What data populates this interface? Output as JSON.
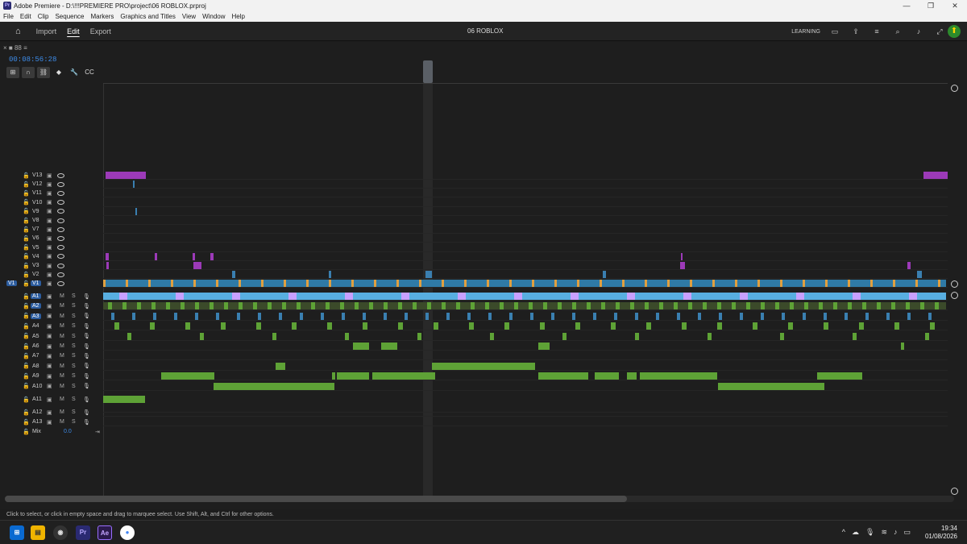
{
  "window": {
    "title": "Adobe Premiere - D:\\!!!PREMIERE PRO\\project\\06 ROBLOX.prproj",
    "controls": [
      "—",
      "❐",
      "✕"
    ]
  },
  "menu": [
    "File",
    "Edit",
    "Clip",
    "Sequence",
    "Markers",
    "Graphics and Titles",
    "View",
    "Window",
    "Help"
  ],
  "header": {
    "tabs": [
      "Import",
      "Edit",
      "Export"
    ],
    "active_tab": "Edit",
    "sequence_name": "06 ROBLOX",
    "learning": "LEARNING"
  },
  "timeline": {
    "panel_label": "× ■ 88 ≡",
    "timecode": "00:08:56:28",
    "video_tracks": [
      "V13",
      "V12",
      "V11",
      "V10",
      "V9",
      "V8",
      "V7",
      "V6",
      "V5",
      "V4",
      "V3",
      "V2",
      "V1"
    ],
    "source_patch": "V1",
    "audio_tracks": [
      "A1",
      "A2",
      "A3",
      "A4",
      "A5",
      "A6",
      "A7",
      "A8",
      "A9",
      "A10",
      "A11",
      "A12",
      "A13"
    ],
    "mix_label": "Mix",
    "mix_value": "0.0",
    "m_label": "M",
    "s_label": "S"
  },
  "status": "Click to select, or click in empty space and drag to marquee select. Use Shift, Alt, and Ctrl for other options.",
  "taskbar": {
    "time": "19:34",
    "date": "01/08/2026",
    "apps": [
      "windows-start",
      "file-explorer",
      "obs",
      "premiere",
      "after-effects",
      "chrome"
    ],
    "pr_label": "Pr",
    "ae_label": "Ae"
  },
  "colors": {
    "accent_blue": "#2c5c9e",
    "video_clip": "#3a7fb0",
    "audio_clip": "#5ea236",
    "purple_clip": "#9c3ab8",
    "timecode": "#3d8be8"
  }
}
